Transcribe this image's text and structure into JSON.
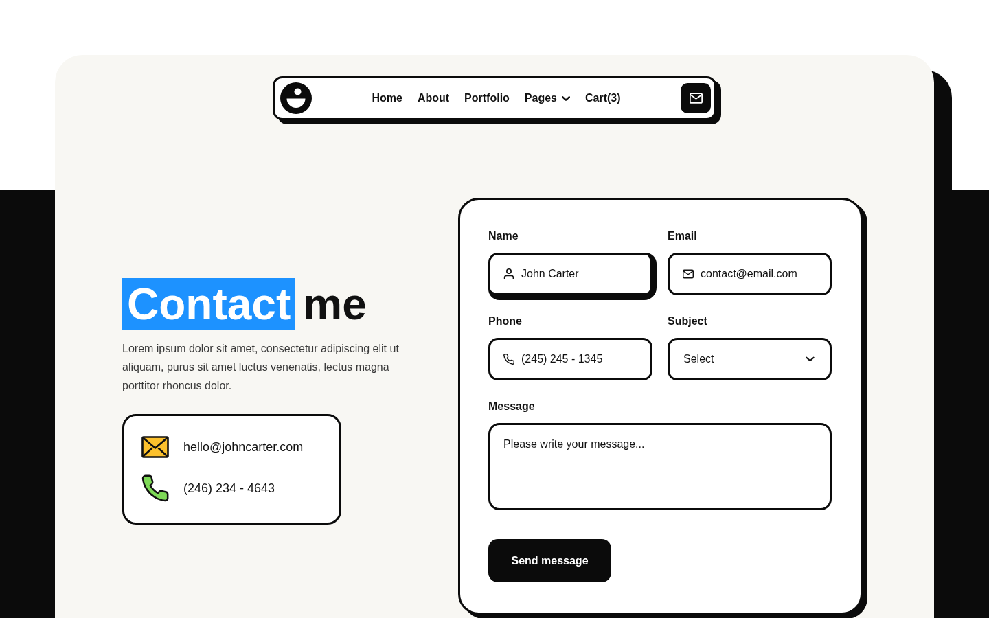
{
  "navbar": {
    "links": [
      {
        "label": "Home",
        "kind": "link"
      },
      {
        "label": "About",
        "kind": "link"
      },
      {
        "label": "Portfolio",
        "kind": "link"
      },
      {
        "label": "Pages",
        "kind": "dropdown"
      },
      {
        "label": "Cart(3)",
        "kind": "link"
      }
    ]
  },
  "hero": {
    "heading_highlight": "Contact",
    "heading_rest": "me",
    "description": "Lorem ipsum dolor sit amet, consectetur adipiscing elit ut aliquam, purus sit amet luctus venenatis, lectus magna porttitor rhoncus dolor."
  },
  "contact_info": [
    {
      "kind": "email",
      "text": "hello@johncarter.com"
    },
    {
      "kind": "phone",
      "text": "(246) 234 - 4643"
    }
  ],
  "form": {
    "fields": [
      {
        "label": "Name",
        "kind": "text",
        "placeholder": "John Carter",
        "focused": true
      },
      {
        "label": "Email",
        "kind": "email",
        "placeholder": "contact@email.com",
        "focused": false
      },
      {
        "label": "Phone",
        "kind": "tel",
        "placeholder": "(245) 245 - 1345",
        "focused": false
      },
      {
        "label": "Subject",
        "kind": "select",
        "placeholder": "Select",
        "focused": false
      },
      {
        "label": "Message",
        "kind": "textarea",
        "placeholder": "Please write your message...",
        "focused": false
      }
    ],
    "submit": {
      "label": "Send message"
    }
  }
}
